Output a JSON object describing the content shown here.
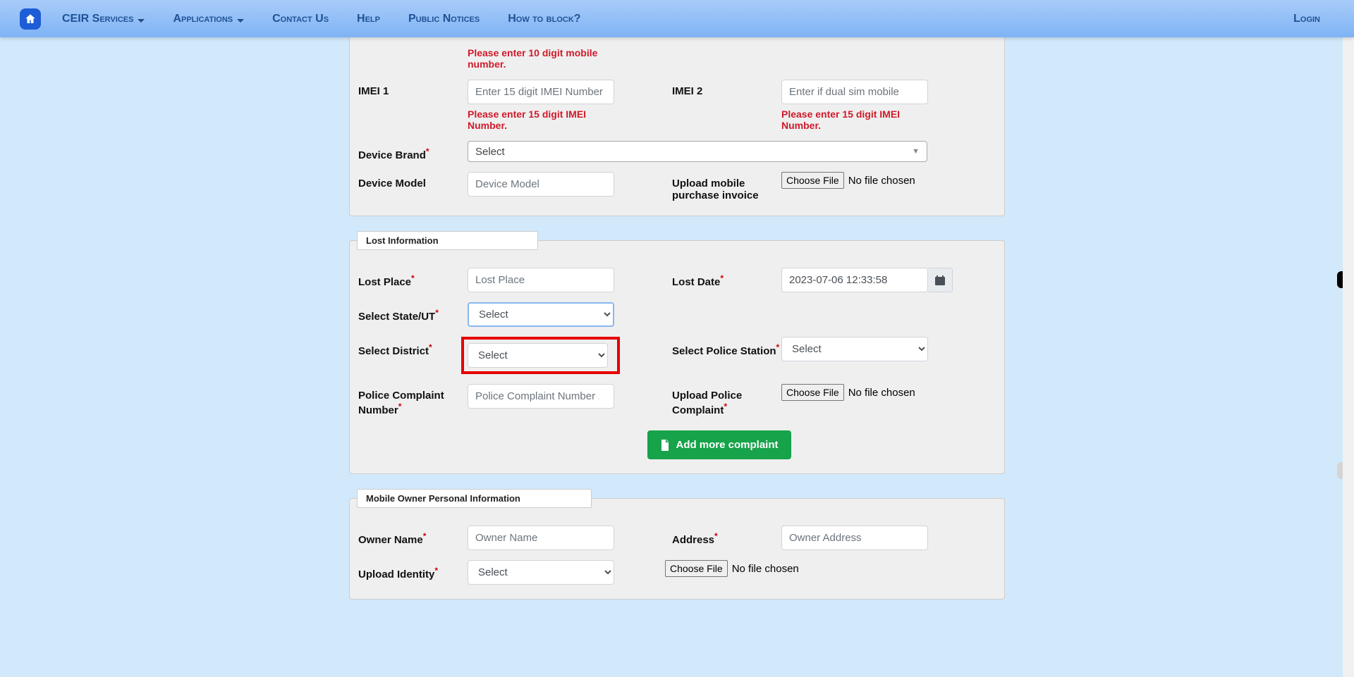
{
  "nav": {
    "ceir_services": "CEIR Services",
    "applications": "Applications",
    "contact_us": "Contact Us",
    "help": "Help",
    "public_notices": "Public Notices",
    "how_to_block": "How to block?",
    "login": "Login"
  },
  "device": {
    "mobile_err": "Please enter 10 digit mobile number.",
    "imei1_label": "IMEI 1",
    "imei1_placeholder": "Enter 15 digit IMEI Number",
    "imei1_err": "Please enter 15 digit IMEI Number.",
    "imei2_label": "IMEI 2",
    "imei2_placeholder": "Enter if dual sim mobile",
    "imei2_err": "Please enter 15 digit IMEI Number.",
    "brand_label": "Device Brand",
    "brand_select": "Select",
    "model_label": "Device Model",
    "model_placeholder": "Device Model",
    "upload_invoice_label": "Upload mobile purchase invoice",
    "choose_file": "Choose File",
    "no_file": "No file chosen"
  },
  "lost": {
    "legend": "Lost Information",
    "place_label": "Lost Place",
    "place_placeholder": "Lost Place",
    "date_label": "Lost Date",
    "date_value": "2023-07-06 12:33:58",
    "state_label": "Select State/UT",
    "state_select": "Select",
    "district_label": "Select District",
    "district_select": "Select",
    "police_station_label": "Select Police Station",
    "police_station_select": "Select",
    "complaint_no_label": "Police Complaint Number",
    "complaint_no_placeholder": "Police Complaint Number",
    "upload_complaint_label": "Upload Police Complaint",
    "choose_file": "Choose File",
    "no_file": "No file chosen",
    "add_more": "Add more complaint"
  },
  "owner": {
    "legend": "Mobile Owner Personal Information",
    "name_label": "Owner Name",
    "name_placeholder": "Owner Name",
    "address_label": "Address",
    "address_placeholder": "Owner Address",
    "identity_label": "Upload Identity",
    "identity_select": "Select",
    "choose_file": "Choose File",
    "no_file": "No file chosen"
  }
}
